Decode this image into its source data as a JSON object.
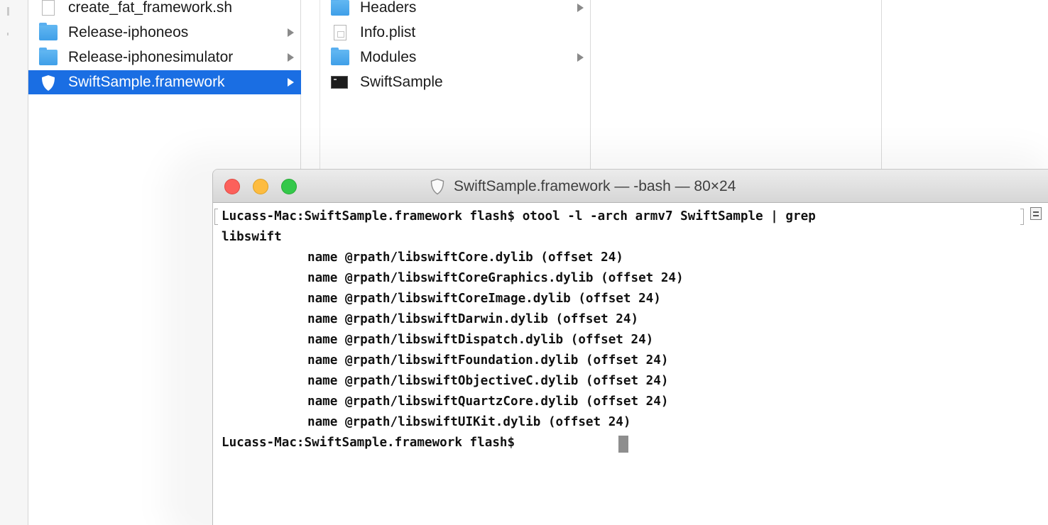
{
  "finder": {
    "column1": [
      {
        "label": "create_fat_framework.sh",
        "icon": "shell-script-file-icon",
        "type": "file"
      },
      {
        "label": "Release-iphoneos",
        "icon": "folder-icon",
        "type": "folder"
      },
      {
        "label": "Release-iphonesimulator",
        "icon": "folder-icon",
        "type": "folder"
      },
      {
        "label": "SwiftSample.framework",
        "icon": "framework-shield-icon",
        "type": "framework",
        "selected": true
      }
    ],
    "column2": [
      {
        "label": "Headers",
        "icon": "folder-icon",
        "type": "folder"
      },
      {
        "label": "Info.plist",
        "icon": "plist-file-icon",
        "type": "file"
      },
      {
        "label": "Modules",
        "icon": "folder-icon",
        "type": "folder"
      },
      {
        "label": "SwiftSample",
        "icon": "unix-executable-icon",
        "type": "executable"
      }
    ],
    "selection_color": "#1a6ee3",
    "folder_color": "#4aa8ec"
  },
  "terminal": {
    "title": "SwiftSample.framework — -bash — 80×24",
    "title_icon": "framework-shield-icon",
    "command_line_1": "Lucass-Mac:SwiftSample.framework flash$ otool -l -arch armv7 SwiftSample | grep",
    "command_line_2": "libswift",
    "output": [
      "name @rpath/libswiftCore.dylib (offset 24)",
      "name @rpath/libswiftCoreGraphics.dylib (offset 24)",
      "name @rpath/libswiftCoreImage.dylib (offset 24)",
      "name @rpath/libswiftDarwin.dylib (offset 24)",
      "name @rpath/libswiftDispatch.dylib (offset 24)",
      "name @rpath/libswiftFoundation.dylib (offset 24)",
      "name @rpath/libswiftObjectiveC.dylib (offset 24)",
      "name @rpath/libswiftQuartzCore.dylib (offset 24)",
      "name @rpath/libswiftUIKit.dylib (offset 24)"
    ],
    "prompt": "Lucass-Mac:SwiftSample.framework flash$",
    "traffic_lights": {
      "close": "#fc605b",
      "minimize": "#fdbc40",
      "zoom": "#34c84a"
    }
  }
}
